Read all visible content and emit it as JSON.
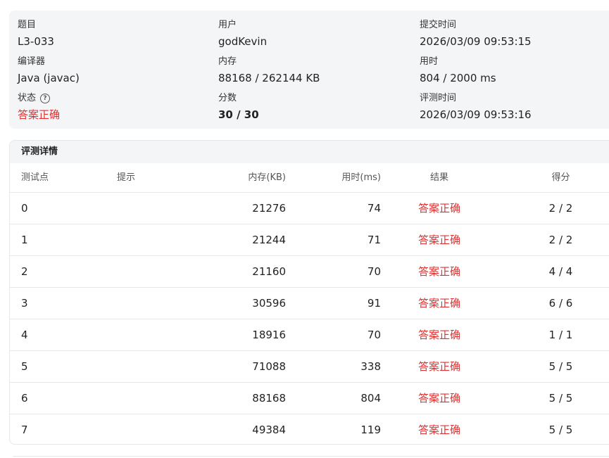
{
  "summary": {
    "problem": {
      "label": "题目",
      "value": "L3-033"
    },
    "user": {
      "label": "用户",
      "value": "godKevin"
    },
    "submit_time": {
      "label": "提交时间",
      "value": "2026/03/09 09:53:15"
    },
    "compiler": {
      "label": "编译器",
      "value": "Java (javac)"
    },
    "memory": {
      "label": "内存",
      "value": "88168 / 262144 KB"
    },
    "time": {
      "label": "用时",
      "value": "804 / 2000 ms"
    },
    "status": {
      "label": "状态",
      "value": "答案正确",
      "help_icon": "question-circle-icon"
    },
    "score": {
      "label": "分数",
      "value": "30 / 30"
    },
    "judge_time": {
      "label": "评测时间",
      "value": "2026/03/09 09:53:16"
    }
  },
  "detail": {
    "title": "评测详情",
    "columns": [
      "测试点",
      "提示",
      "内存(KB)",
      "用时(ms)",
      "结果",
      "得分"
    ],
    "rows": [
      {
        "case": "0",
        "hint": "",
        "memory": "21276",
        "time": "74",
        "result": "答案正确",
        "score": "2 / 2"
      },
      {
        "case": "1",
        "hint": "",
        "memory": "21244",
        "time": "71",
        "result": "答案正确",
        "score": "2 / 2"
      },
      {
        "case": "2",
        "hint": "",
        "memory": "21160",
        "time": "70",
        "result": "答案正确",
        "score": "4 / 4"
      },
      {
        "case": "3",
        "hint": "",
        "memory": "30596",
        "time": "91",
        "result": "答案正确",
        "score": "6 / 6"
      },
      {
        "case": "4",
        "hint": "",
        "memory": "18916",
        "time": "70",
        "result": "答案正确",
        "score": "1 / 1"
      },
      {
        "case": "5",
        "hint": "",
        "memory": "71088",
        "time": "338",
        "result": "答案正确",
        "score": "5 / 5"
      },
      {
        "case": "6",
        "hint": "",
        "memory": "88168",
        "time": "804",
        "result": "答案正确",
        "score": "5 / 5"
      },
      {
        "case": "7",
        "hint": "",
        "memory": "49384",
        "time": "119",
        "result": "答案正确",
        "score": "5 / 5"
      }
    ]
  },
  "colors": {
    "accepted": "#e03131",
    "panel_bg": "#f4f5f7",
    "border": "#e6e7ea"
  }
}
